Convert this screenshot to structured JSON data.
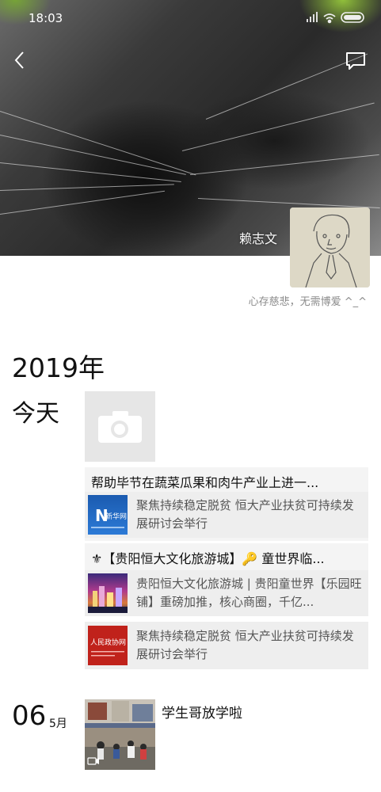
{
  "status": {
    "time": "18:03"
  },
  "profile": {
    "name": "赖志文",
    "signature": "心存慈悲，无需博爱 ^_^"
  },
  "timeline": {
    "year": "2019年",
    "today_label": "今天",
    "posts": [
      {
        "title": "帮助毕节在蔬菜瓜果和肉牛产业上进一...",
        "link_text": "聚焦持续稳定脱贫 恒大产业扶贫可持续发展研讨会举行",
        "thumb_brand": "新华网"
      },
      {
        "title": "⚜【贵阳恒大文化旅游城】🔑 童世界临...",
        "link_text": "贵阳恒大文化旅游城 | 贵阳童世界【乐园旺铺】重磅加推，核心商圈，千亿...",
        "thumb_brand": ""
      },
      {
        "title": "",
        "link_text": "聚焦持续稳定脱贫 恒大产业扶贫可持续发展研讨会举行",
        "thumb_brand": "人民政协网"
      }
    ],
    "entry2": {
      "day": "06",
      "month": "5月",
      "caption": "学生哥放学啦"
    }
  },
  "icons": [
    "back-icon",
    "comment-icon",
    "camera-icon",
    "signal-icon",
    "wifi-icon",
    "battery-icon",
    "video-icon"
  ]
}
